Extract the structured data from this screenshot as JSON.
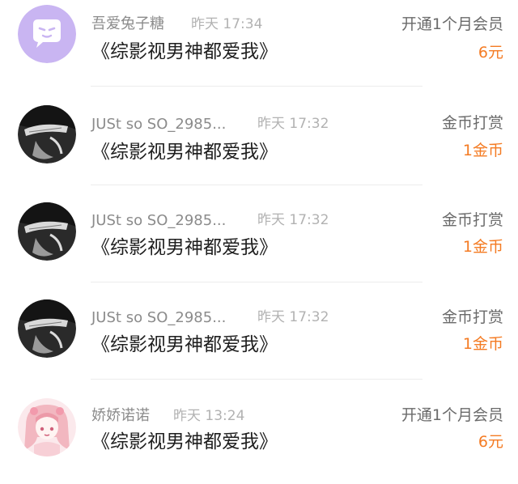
{
  "colors": {
    "accent": "#f47b23",
    "name_text": "#8b8b8b",
    "time_text": "#b2b2b2",
    "title_text": "#1f1f1f",
    "action_text": "#6a6a6a"
  },
  "records": [
    {
      "user": "吾爱兔子糖",
      "time": "昨天 17:34",
      "book": "《综影视男神都爱我》",
      "action": "开通1个月会员",
      "amount": "6元",
      "avatar": "purple-chat-bubble-avatar"
    },
    {
      "user": "JUSt so SO_2985...",
      "time": "昨天 17:32",
      "book": "《综影视男神都爱我》",
      "action": "金币打赏",
      "amount": "1金币",
      "avatar": "black-white-photo-avatar"
    },
    {
      "user": "JUSt so SO_2985...",
      "time": "昨天 17:32",
      "book": "《综影视男神都爱我》",
      "action": "金币打赏",
      "amount": "1金币",
      "avatar": "black-white-photo-avatar"
    },
    {
      "user": "JUSt so SO_2985...",
      "time": "昨天 17:32",
      "book": "《综影视男神都爱我》",
      "action": "金币打赏",
      "amount": "1金币",
      "avatar": "black-white-photo-avatar"
    },
    {
      "user": "娇娇诺诺",
      "time": "昨天 13:24",
      "book": "《综影视男神都爱我》",
      "action": "开通1个月会员",
      "amount": "6元",
      "avatar": "pink-anime-girl-avatar"
    }
  ]
}
